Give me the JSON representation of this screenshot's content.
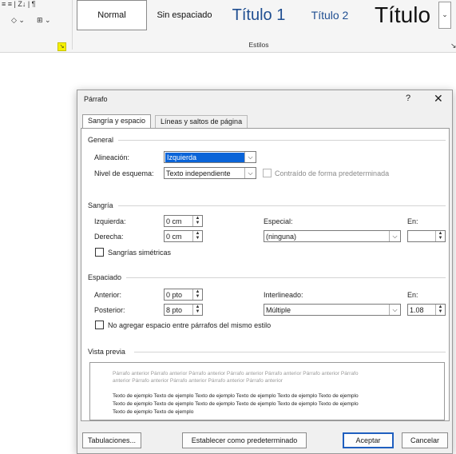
{
  "ribbon": {
    "styles": {
      "normal": "Normal",
      "sin_espaciado": "Sin espaciado",
      "titulo1": "Título 1",
      "titulo2": "Título 2",
      "titulo": "Título"
    },
    "group_label": "Estilos",
    "launcher_icon": "dialog-launcher-icon",
    "highlight_color": "#f5f000"
  },
  "dialog": {
    "title": "Párrafo",
    "help": "?",
    "close": "✕",
    "tabs": [
      "Sangría y espacio",
      "Líneas y saltos de página"
    ],
    "general": {
      "heading": "General",
      "alineacion_label": "Alineación:",
      "alineacion_value": "Izquierda",
      "nivel_label": "Nivel de esquema:",
      "nivel_value": "Texto independiente",
      "contraido_label": "Contraído de forma predeterminada"
    },
    "sangria": {
      "heading": "Sangría",
      "izquierda_label": "Izquierda:",
      "izquierda_value": "0 cm",
      "derecha_label": "Derecha:",
      "derecha_value": "0 cm",
      "especial_label": "Especial:",
      "especial_value": "(ninguna)",
      "en_label": "En:",
      "en_value": "",
      "simetricas_label": "Sangrías simétricas"
    },
    "espaciado": {
      "heading": "Espaciado",
      "anterior_label": "Anterior:",
      "anterior_value": "0 pto",
      "posterior_label": "Posterior:",
      "posterior_value": "8 pto",
      "interlineado_label": "Interlineado:",
      "interlineado_value": "Múltiple",
      "en_label": "En:",
      "en_value": "1.08",
      "no_agregar_label": "No agregar espacio entre párrafos del mismo estilo"
    },
    "vista_previa": {
      "heading": "Vista previa",
      "prev_line1": "Párrafo anterior Párrafo anterior Párrafo anterior Párrafo anterior Párrafo anterior Párrafo anterior Párrafo",
      "prev_line2": "anterior Párrafo anterior Párrafo anterior Párrafo anterior Párrafo anterior",
      "sample_line1": "Texto de ejemplo Texto de ejemplo Texto de ejemplo Texto de ejemplo Texto de ejemplo Texto de ejemplo",
      "sample_line2": "Texto de ejemplo Texto de ejemplo Texto de ejemplo Texto de ejemplo Texto de ejemplo Texto de ejemplo",
      "sample_line3": "Texto de ejemplo Texto de ejemplo"
    },
    "buttons": {
      "tabulaciones": "Tabulaciones...",
      "establecer": "Establecer como predeterminado",
      "aceptar": "Aceptar",
      "cancelar": "Cancelar"
    }
  }
}
